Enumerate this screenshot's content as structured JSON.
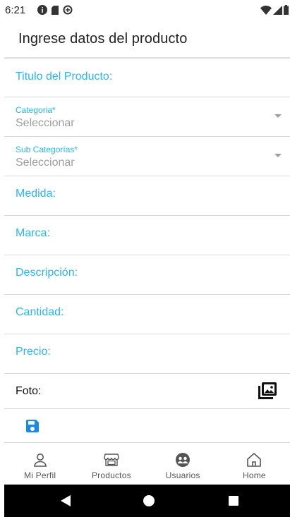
{
  "status_bar": {
    "time": "6:21",
    "left_icons": [
      "info-icon",
      "sim-card-icon",
      "data-saver-icon"
    ],
    "right_icons": [
      "wifi-icon",
      "cellular-signal-icon",
      "battery-icon"
    ]
  },
  "header": {
    "title": "Ingrese datos del producto"
  },
  "form": {
    "fields": [
      {
        "label": "Titulo del Producto:"
      },
      {
        "label": "Categoria*",
        "value": "Seleccionar"
      },
      {
        "label": "Sub Categorías*",
        "value": "Seleccionar"
      },
      {
        "label": "Medida:"
      },
      {
        "label": "Marca:"
      },
      {
        "label": "Descripción:"
      },
      {
        "label": "Cantidad:"
      },
      {
        "label": "Precio:"
      }
    ],
    "photo_label": "Foto:"
  },
  "bottom_nav": {
    "items": [
      {
        "label": "Mi Perfil",
        "icon": "person-icon"
      },
      {
        "label": "Productos",
        "icon": "store-icon"
      },
      {
        "label": "Usuarios",
        "icon": "users-icon"
      },
      {
        "label": "Home",
        "icon": "home-icon"
      }
    ]
  },
  "colors": {
    "accent": "#29b6f6",
    "save_icon": "#1e88e5",
    "placeholder": "#9e9e9e",
    "divider": "#d7d7d7"
  }
}
